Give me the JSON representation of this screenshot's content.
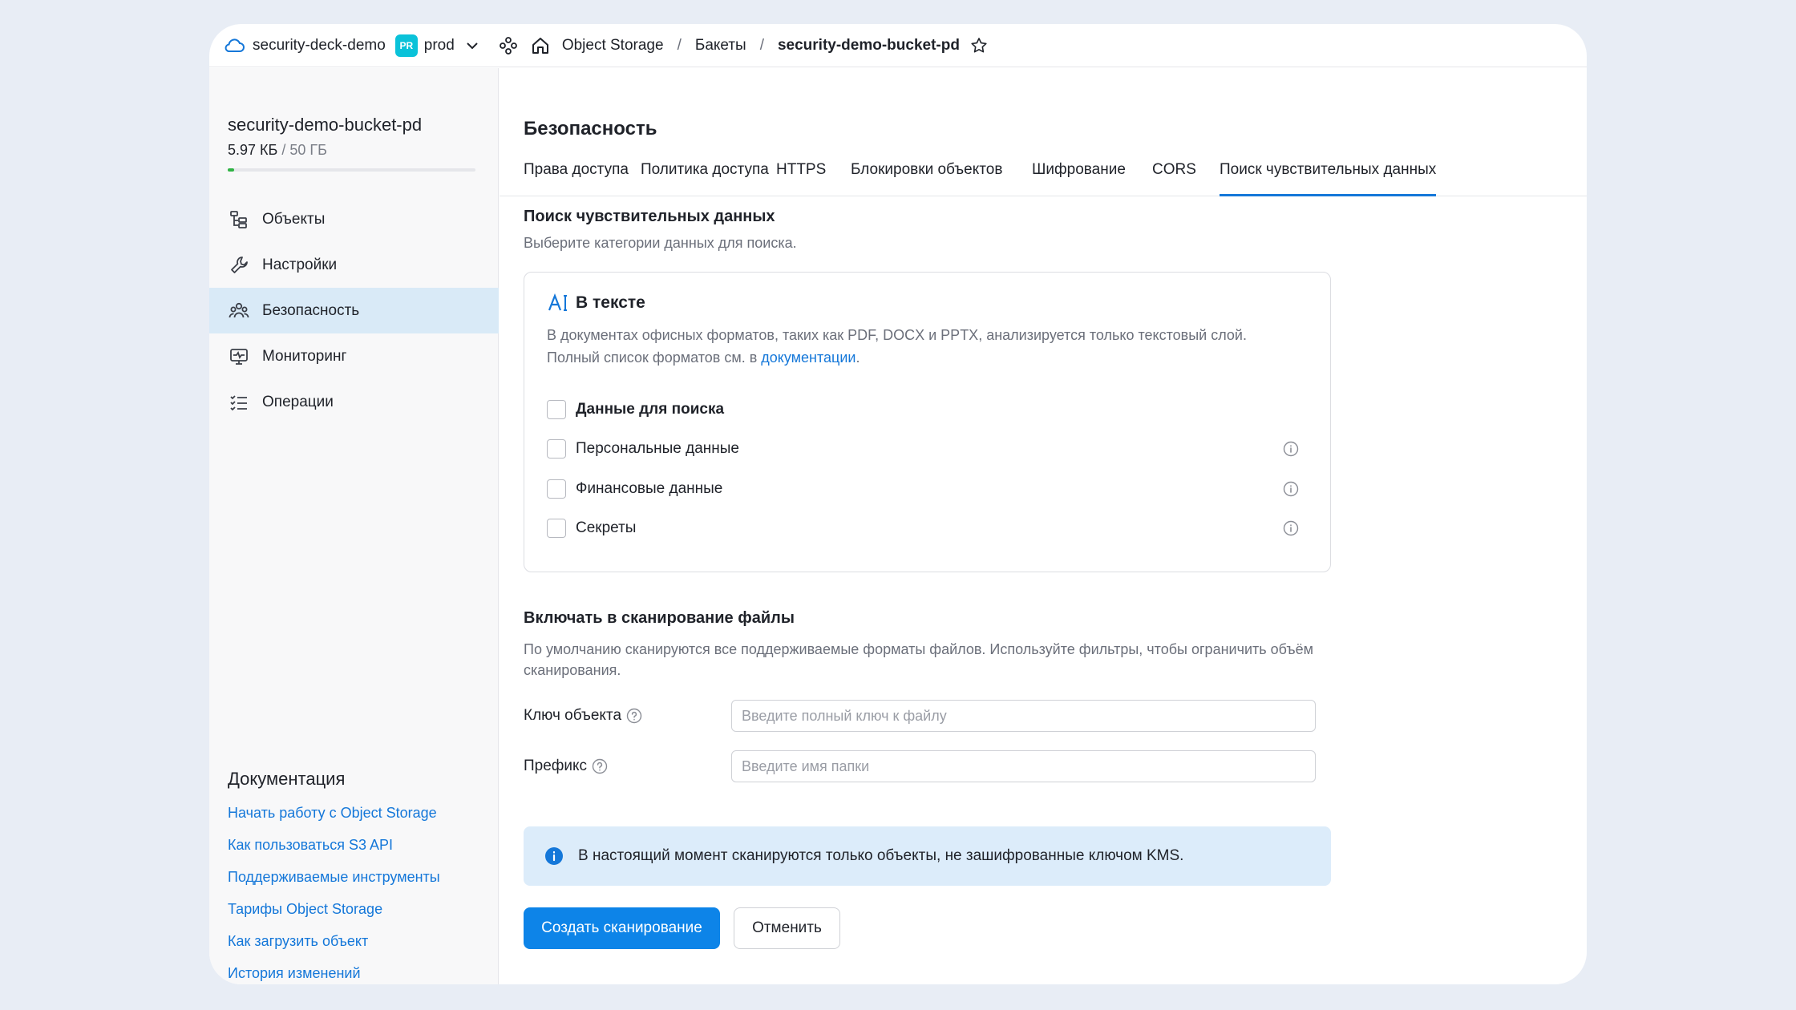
{
  "topbar": {
    "cloud_name": "security-deck-demo",
    "env_badge": "PR",
    "env_name": "prod",
    "service": "Object Storage",
    "buckets": "Бакеты",
    "current_bucket": "security-demo-bucket-pd",
    "badge_color": "#0ac2d9"
  },
  "sidebar": {
    "bucket_name": "security-demo-bucket-pd",
    "usage_used": "5.97 КБ",
    "usage_total": "/ 50 ГБ",
    "usage_fraction": 0.0001,
    "items": [
      {
        "label": "Объекты",
        "icon": "objects-icon"
      },
      {
        "label": "Настройки",
        "icon": "wrench-icon"
      },
      {
        "label": "Безопасность",
        "icon": "people-icon"
      },
      {
        "label": "Мониторинг",
        "icon": "monitor-icon"
      },
      {
        "label": "Операции",
        "icon": "list-icon"
      }
    ],
    "docs_title": "Документация",
    "docs_links": [
      "Начать работу с Object Storage",
      "Как пользоваться S3 API",
      "Поддерживаемые инструменты",
      "Тарифы Object Storage",
      "Как загрузить объект",
      "История изменений"
    ]
  },
  "main": {
    "title": "Безопасность",
    "tabs": [
      "Права доступа",
      "Политика доступа",
      "HTTPS",
      "Блокировки объектов",
      "Шифрование",
      "CORS",
      "Поиск чувствительных данных"
    ],
    "active_tab": "Поиск чувствительных данных",
    "section1_title": "Поиск чувствительных данных",
    "section1_sub": "Выберите категории данных для поиска.",
    "card": {
      "title": "В тексте",
      "desc_line1": "В документах офисных форматов, таких как PDF, DOCX и PPTX, анализируется только текстовый слой.",
      "desc_line2_prefix": "Полный список форматов см. в ",
      "desc_link": "документации",
      "desc_suffix": ".",
      "options": [
        "Данные для поиска",
        "Персональные данные",
        "Финансовые данные",
        "Секреты"
      ]
    },
    "section2_title": "Включать в сканирование файлы",
    "section2_sub": "По умолчанию сканируются все поддерживаемые форматы файлов. Используйте фильтры, чтобы ограничить объём сканирования.",
    "fields": {
      "key_label": "Ключ объекта",
      "key_placeholder": "Введите полный ключ к файлу",
      "prefix_label": "Префикс",
      "prefix_placeholder": "Введите имя папки"
    },
    "notice": "В настоящий момент сканируются только объекты, не зашифрованные ключом KMS.",
    "buttons": {
      "create": "Создать сканирование",
      "cancel": "Отменить"
    },
    "accent_color": "#0d84e8"
  }
}
